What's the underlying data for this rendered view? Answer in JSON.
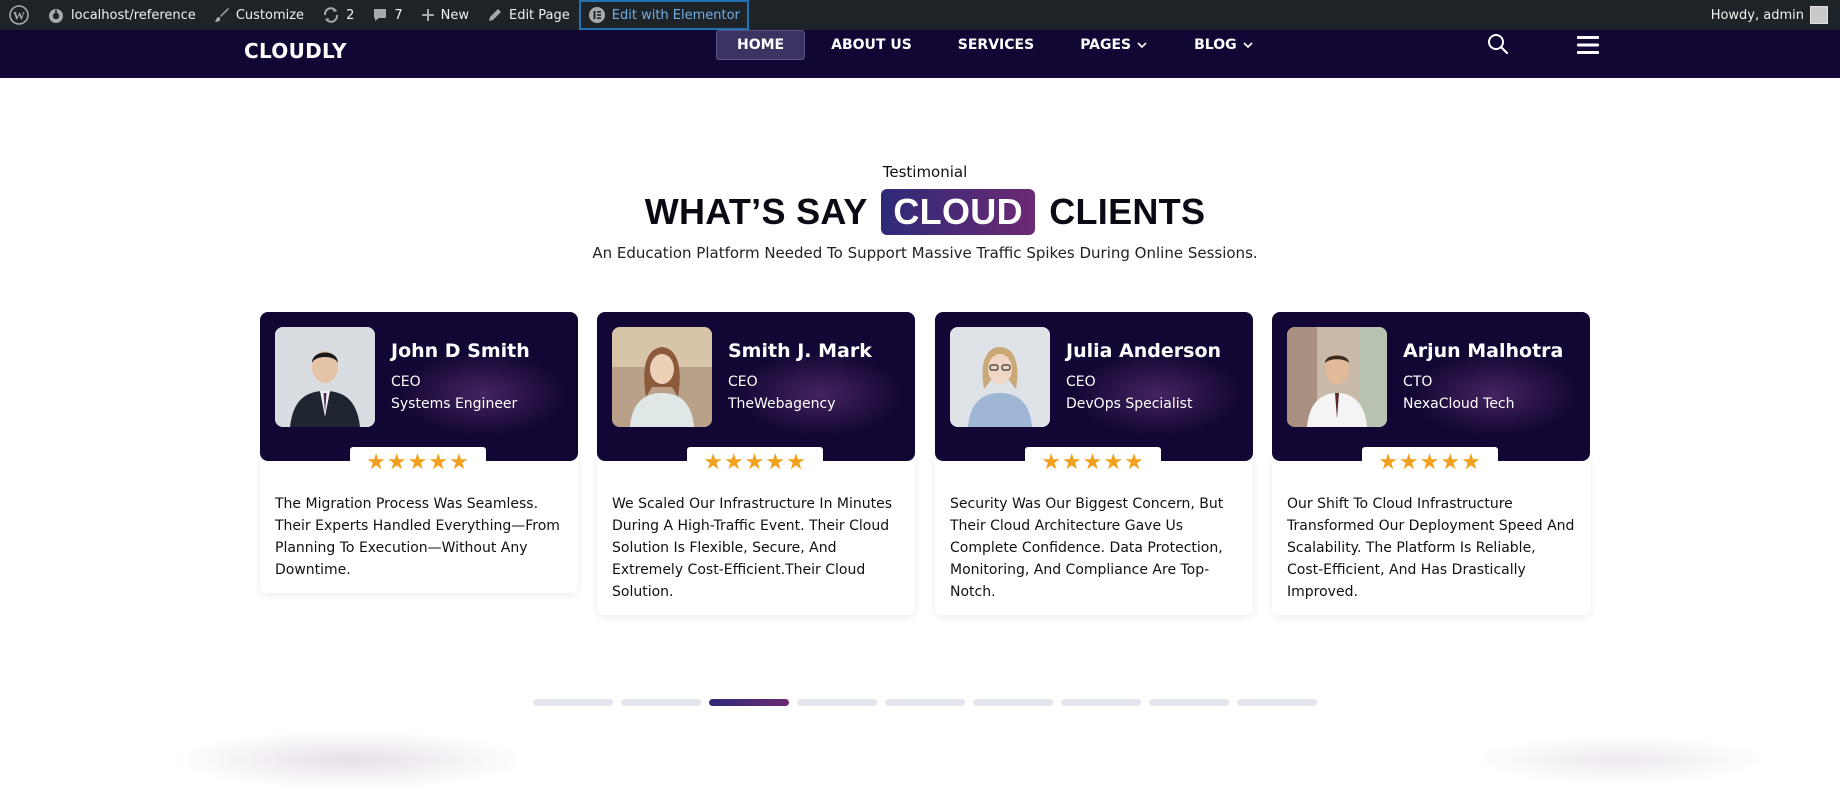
{
  "admin_bar": {
    "site": "localhost/reference",
    "customize": "Customize",
    "updates_count": "2",
    "comments_count": "7",
    "new": "New",
    "edit_page": "Edit Page",
    "edit_elementor": "Edit with Elementor",
    "greeting": "Howdy, admin"
  },
  "header": {
    "logo": "CLOUDLY",
    "nav": [
      "HOME",
      "ABOUT US",
      "SERVICES",
      "PAGES",
      "BLOG"
    ]
  },
  "section": {
    "eyebrow": "Testimonial",
    "title_before": "WHAT’S SAY",
    "title_highlight": "CLOUD",
    "title_after": "CLIENTS",
    "subtitle": "An Education Platform Needed To Support Massive Traffic Spikes During Online Sessions."
  },
  "testimonials": [
    {
      "name": "John D Smith",
      "role": "CEO",
      "company": "Systems Engineer",
      "stars": "★★★★★",
      "quote": "The Migration Process Was Seamless. Their Experts Handled Everything—From Planning To Execution—Without Any Downtime."
    },
    {
      "name": "Smith J. Mark",
      "role": "CEO",
      "company": "TheWebagency",
      "stars": "★★★★★",
      "quote": "We Scaled Our Infrastructure In Minutes During A High-Traffic Event. Their Cloud Solution Is Flexible, Secure, And Extremely Cost-Efficient.Their Cloud Solution."
    },
    {
      "name": "Julia Anderson",
      "role": "CEO",
      "company": "DevOps Specialist",
      "stars": "★★★★★",
      "quote": "Security Was Our Biggest Concern, But Their Cloud Architecture Gave Us Complete Confidence. Data Protection, Monitoring, And Compliance Are Top-Notch."
    },
    {
      "name": "Arjun Malhotra",
      "role": "CTO",
      "company": "NexaCloud Tech",
      "stars": "★★★★★",
      "quote": "Our Shift To Cloud Infrastructure Transformed Our Deployment Speed And Scalability. The Platform Is Reliable, Cost-Efficient, And Has Drastically Improved."
    }
  ],
  "pagination": {
    "total": 9,
    "active_index": 2
  },
  "colors": {
    "header_bg": "#120634",
    "star": "#f1a11e",
    "accent_start": "#2d2a78",
    "accent_end": "#6d2a73",
    "admin_bar": "#1d2327"
  }
}
